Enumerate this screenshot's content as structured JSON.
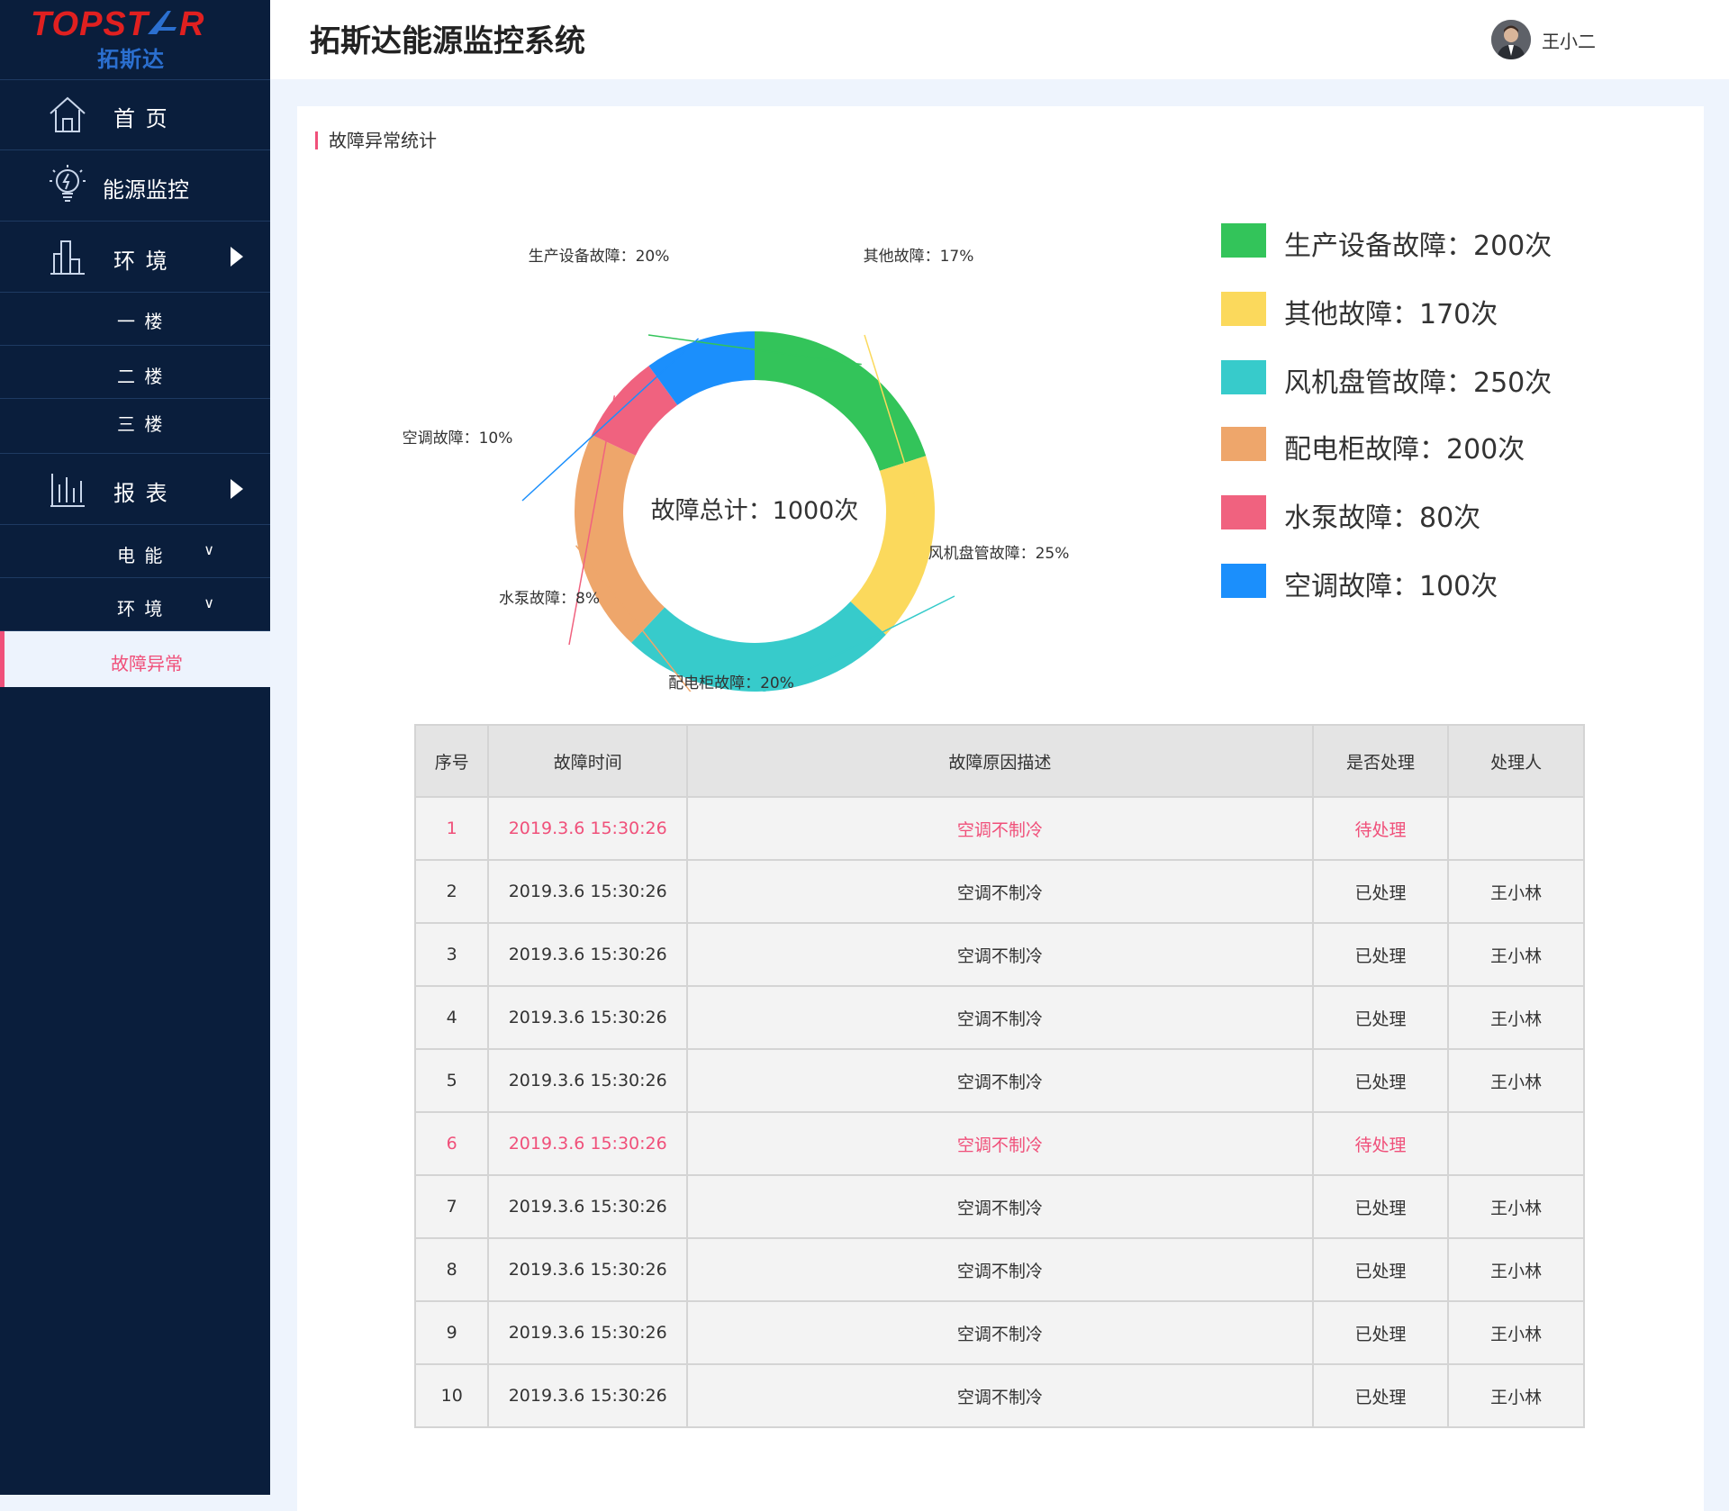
{
  "brand": {
    "logo_top": "TOPST",
    "logo_top_tail": "R",
    "logo_bottom": "拓斯达"
  },
  "header": {
    "title": "拓斯达能源监控系统",
    "user_name": "王小二"
  },
  "sidebar": {
    "items": [
      {
        "label": "首  页",
        "icon": "home-icon"
      },
      {
        "label": "能源监控",
        "icon": "bulb-icon"
      },
      {
        "label": "环  境",
        "icon": "building-icon"
      },
      {
        "label": "一  楼"
      },
      {
        "label": "二  楼"
      },
      {
        "label": "三  楼"
      },
      {
        "label": "报  表",
        "icon": "bar-chart-icon"
      },
      {
        "label": "电  能"
      },
      {
        "label": "环  境"
      },
      {
        "label": "故障异常"
      }
    ]
  },
  "section": {
    "title": "故障异常统计"
  },
  "chart_data": {
    "type": "pie",
    "center_label": "故障总计：1000次",
    "slices": [
      {
        "name": "生产设备故障",
        "value": 200,
        "percent_label": "生产设备故障：20%",
        "legend": "生产设备故障：200次",
        "color": "#33c45a"
      },
      {
        "name": "其他故障",
        "value": 170,
        "percent_label": "其他故障：17%",
        "legend": "其他故障：170次",
        "color": "#fbd95c"
      },
      {
        "name": "风机盘管故障",
        "value": 250,
        "percent_label": "风机盘管故障：25%",
        "legend": "风机盘管故障：250次",
        "color": "#37cbcb"
      },
      {
        "name": "配电柜故障",
        "value": 200,
        "percent_label": "配电柜故障：20%",
        "legend": "配电柜故障：200次",
        "color": "#eea66b"
      },
      {
        "name": "水泵故障",
        "value": 80,
        "percent_label": "水泵故障：8%",
        "legend": "水泵故障：80次",
        "color": "#f0627f"
      },
      {
        "name": "空调故障",
        "value": 100,
        "percent_label": "空调故障：10%",
        "legend": "空调故障：100次",
        "color": "#1b8ffc"
      }
    ]
  },
  "table": {
    "headers": [
      "序号",
      "故障时间",
      "故障原因描述",
      "是否处理",
      "处理人"
    ],
    "rows": [
      {
        "cells": [
          "1",
          "2019.3.6  15:30:26",
          "空调不制冷",
          "待处理",
          ""
        ],
        "pending": true
      },
      {
        "cells": [
          "2",
          "2019.3.6  15:30:26",
          "空调不制冷",
          "已处理",
          "王小林"
        ],
        "pending": false
      },
      {
        "cells": [
          "3",
          "2019.3.6  15:30:26",
          "空调不制冷",
          "已处理",
          "王小林"
        ],
        "pending": false
      },
      {
        "cells": [
          "4",
          "2019.3.6  15:30:26",
          "空调不制冷",
          "已处理",
          "王小林"
        ],
        "pending": false
      },
      {
        "cells": [
          "5",
          "2019.3.6  15:30:26",
          "空调不制冷",
          "已处理",
          "王小林"
        ],
        "pending": false
      },
      {
        "cells": [
          "6",
          "2019.3.6  15:30:26",
          "空调不制冷",
          "待处理",
          ""
        ],
        "pending": true
      },
      {
        "cells": [
          "7",
          "2019.3.6  15:30:26",
          "空调不制冷",
          "已处理",
          "王小林"
        ],
        "pending": false
      },
      {
        "cells": [
          "8",
          "2019.3.6  15:30:26",
          "空调不制冷",
          "已处理",
          "王小林"
        ],
        "pending": false
      },
      {
        "cells": [
          "9",
          "2019.3.6  15:30:26",
          "空调不制冷",
          "已处理",
          "王小林"
        ],
        "pending": false
      },
      {
        "cells": [
          "10",
          "2019.3.6  15:30:26",
          "空调不制冷",
          "已处理",
          "王小林"
        ],
        "pending": false
      }
    ]
  },
  "colors": {
    "sidebar_bg": "#0a1e3c",
    "accent": "#f0507a",
    "page_bg": "#eef4fd"
  }
}
